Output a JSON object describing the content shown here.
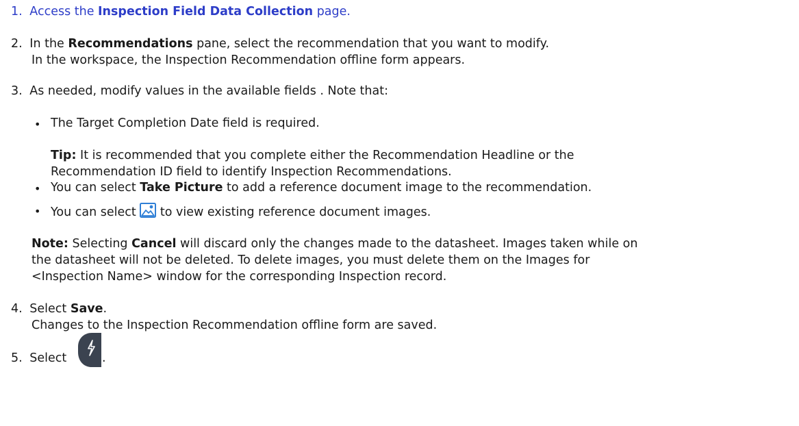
{
  "steps": [
    {
      "num": "1.",
      "pre": "Access the ",
      "link_bold": "Inspection Field Data Collection",
      "post": " page."
    },
    {
      "num": "2.",
      "pre": "In the ",
      "bold": "Recommendations",
      "post": " pane, select the recommendation that you want to modify.",
      "result": "In the workspace, the Inspection Recommendation offline form appears."
    },
    {
      "num": "3.",
      "text": "As needed, modify values in the available fields . Note that:",
      "bullets": [
        {
          "text": "The Target Completion Date field is required."
        },
        {
          "pre": "You can select ",
          "bold": "Take Picture",
          "post": " to add a reference document image to the recommendation."
        },
        {
          "pre": "You can select ",
          "icon": "image-gallery-icon",
          "post": " to view existing reference document images."
        }
      ],
      "tip": {
        "label": "Tip:",
        "line1": " It is recommended that you complete either the Recommendation Headline or the",
        "line2": "Recommendation ID field to identify Inspection Recommendations."
      },
      "note": {
        "label": "Note:",
        "l1_pre": " Selecting ",
        "l1_bold": "Cancel",
        "l1_post": " will discard only the changes made to the datasheet.  Images taken while on",
        "line2": "the datasheet will not be deleted. To delete images, you must delete them on the Images for",
        "line3": "<Inspection Name> window for the corresponding Inspection record."
      }
    },
    {
      "num": "4.",
      "pre": "Select ",
      "bold": "Save",
      "post": ".",
      "result": "Changes to the Inspection Recommendation offline form are saved."
    },
    {
      "num": "5.",
      "pre": "Select ",
      "icon": "sync-button-icon",
      "post": "."
    }
  ]
}
